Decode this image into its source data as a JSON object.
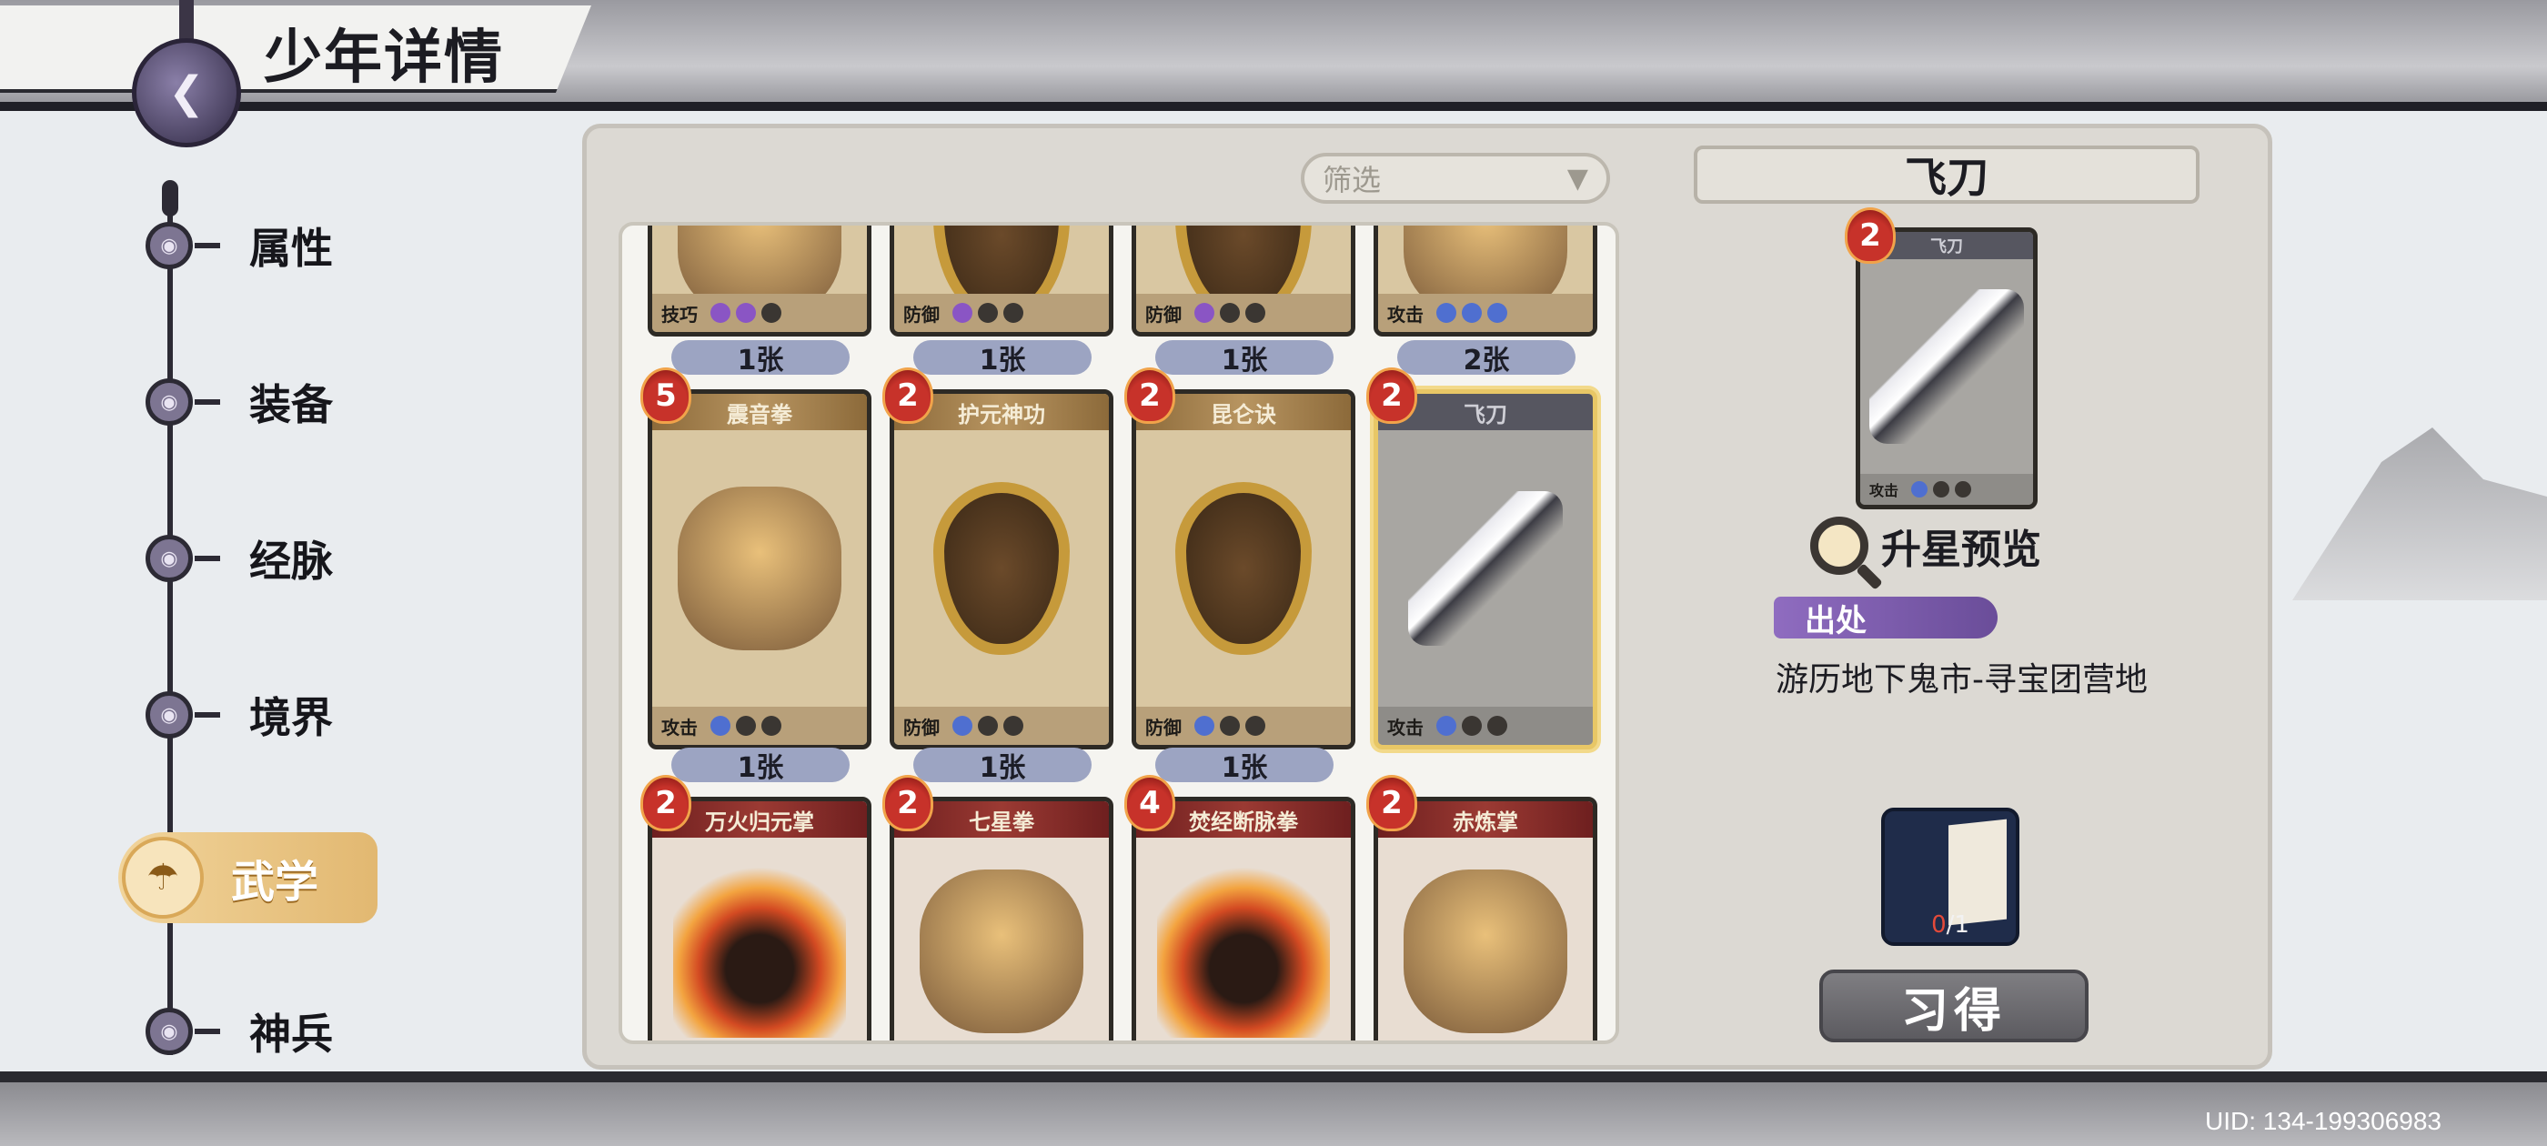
{
  "header": {
    "title": "少年详情",
    "back_icon": "back-arrow-icon"
  },
  "nav": {
    "items": [
      {
        "label": "属性"
      },
      {
        "label": "装备"
      },
      {
        "label": "经脉"
      },
      {
        "label": "境界"
      },
      {
        "label": "武学",
        "active": true
      },
      {
        "label": "神兵"
      }
    ]
  },
  "filter": {
    "label": "筛选"
  },
  "cards": {
    "row1": [
      {
        "name": "",
        "type": "技巧",
        "dots": [
          "purple",
          "purple",
          "off"
        ],
        "count": "1张"
      },
      {
        "name": "",
        "type": "防御",
        "dots": [
          "purple",
          "off",
          "off"
        ],
        "count": "1张"
      },
      {
        "name": "",
        "type": "防御",
        "dots": [
          "purple",
          "off",
          "off"
        ],
        "count": "1张"
      },
      {
        "name": "",
        "type": "攻击",
        "dots": [
          "blue",
          "blue",
          "blue"
        ],
        "count": "2张"
      }
    ],
    "row2": [
      {
        "cost": "5",
        "name": "震音拳",
        "type": "攻击",
        "count": "1张"
      },
      {
        "cost": "2",
        "name": "护元神功",
        "type": "防御",
        "count": "1张"
      },
      {
        "cost": "2",
        "name": "昆仑诀",
        "type": "防御",
        "count": "1张"
      },
      {
        "cost": "2",
        "name": "飞刀",
        "type": "攻击"
      }
    ],
    "row3": [
      {
        "cost": "2",
        "name": "万火归元掌"
      },
      {
        "cost": "2",
        "name": "七星拳"
      },
      {
        "cost": "4",
        "name": "焚经断脉拳"
      },
      {
        "cost": "2",
        "name": "赤炼掌"
      }
    ]
  },
  "detail": {
    "name": "飞刀",
    "card": {
      "cost": "2",
      "name": "飞刀",
      "type": "攻击"
    },
    "upgrade_label": "升星预览",
    "source_tag": "出处",
    "source_text": "游历地下鬼市-寻宝团营地",
    "book_count_have": "0",
    "book_count_need": "/1",
    "learn_button": "习得"
  },
  "footer": {
    "uid": "UID: 134-199306983"
  },
  "colors": {
    "accent_gold": "#e2b871",
    "card_cost_red": "#c7322a",
    "source_purple": "#8f6cc0"
  }
}
